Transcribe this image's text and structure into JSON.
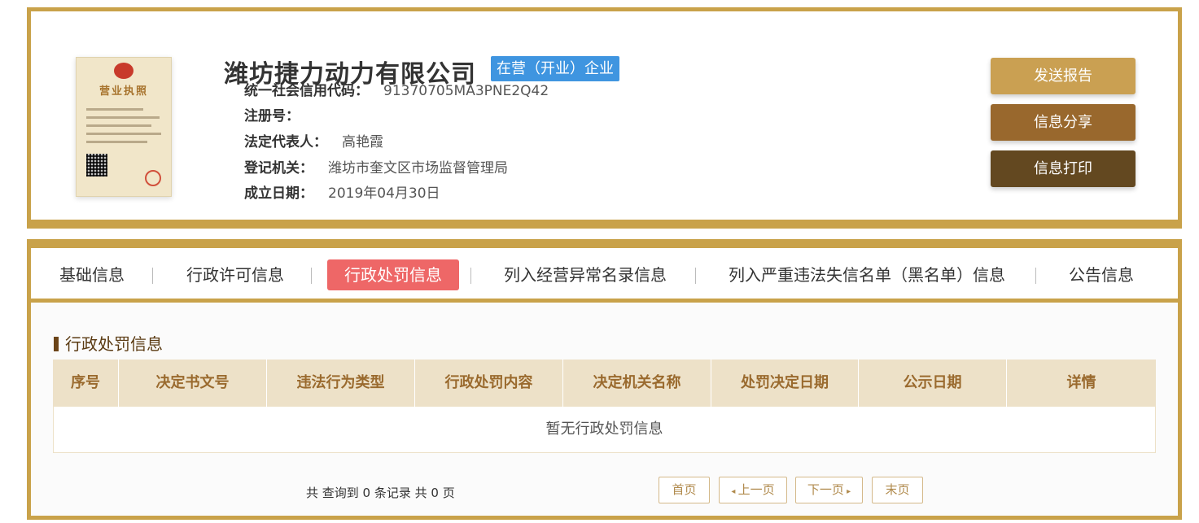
{
  "company": {
    "name": "潍坊捷力动力有限公司",
    "status": "在营（开业）企业",
    "license_title": "营业执照",
    "fields": [
      {
        "label": "统一社会信用代码：",
        "value": "91370705MA3PNE2Q42"
      },
      {
        "label": "注册号：",
        "value": ""
      },
      {
        "label": "法定代表人：",
        "value": "高艳霞"
      },
      {
        "label": "登记机关：",
        "value": "潍坊市奎文区市场监督管理局"
      },
      {
        "label": "成立日期：",
        "value": "2019年04月30日"
      }
    ]
  },
  "actions": {
    "report": "发送报告",
    "share": "信息分享",
    "print": "信息打印"
  },
  "tabs": [
    {
      "label": "基础信息"
    },
    {
      "label": "行政许可信息"
    },
    {
      "label": "行政处罚信息",
      "active": true
    },
    {
      "label": "列入经营异常名录信息"
    },
    {
      "label": "列入严重违法失信名单（黑名单）信息"
    },
    {
      "label": "公告信息"
    }
  ],
  "section": {
    "title": "行政处罚信息",
    "columns": [
      "序号",
      "决定书文号",
      "违法行为类型",
      "行政处罚内容",
      "决定机关名称",
      "处罚决定日期",
      "公示日期",
      "详情"
    ],
    "empty_text": "暂无行政处罚信息"
  },
  "pagination": {
    "summary": "共 查询到 0 条记录 共 0 页",
    "first": "首页",
    "prev": "上一页",
    "next": "下一页",
    "last": "末页"
  },
  "colors": {
    "gold_border": "#c9a24a",
    "badge_blue": "#3f95e0",
    "active_tab": "#ee6767",
    "btn_report": "#caa052",
    "btn_share": "#99682d",
    "btn_print": "#634820"
  }
}
